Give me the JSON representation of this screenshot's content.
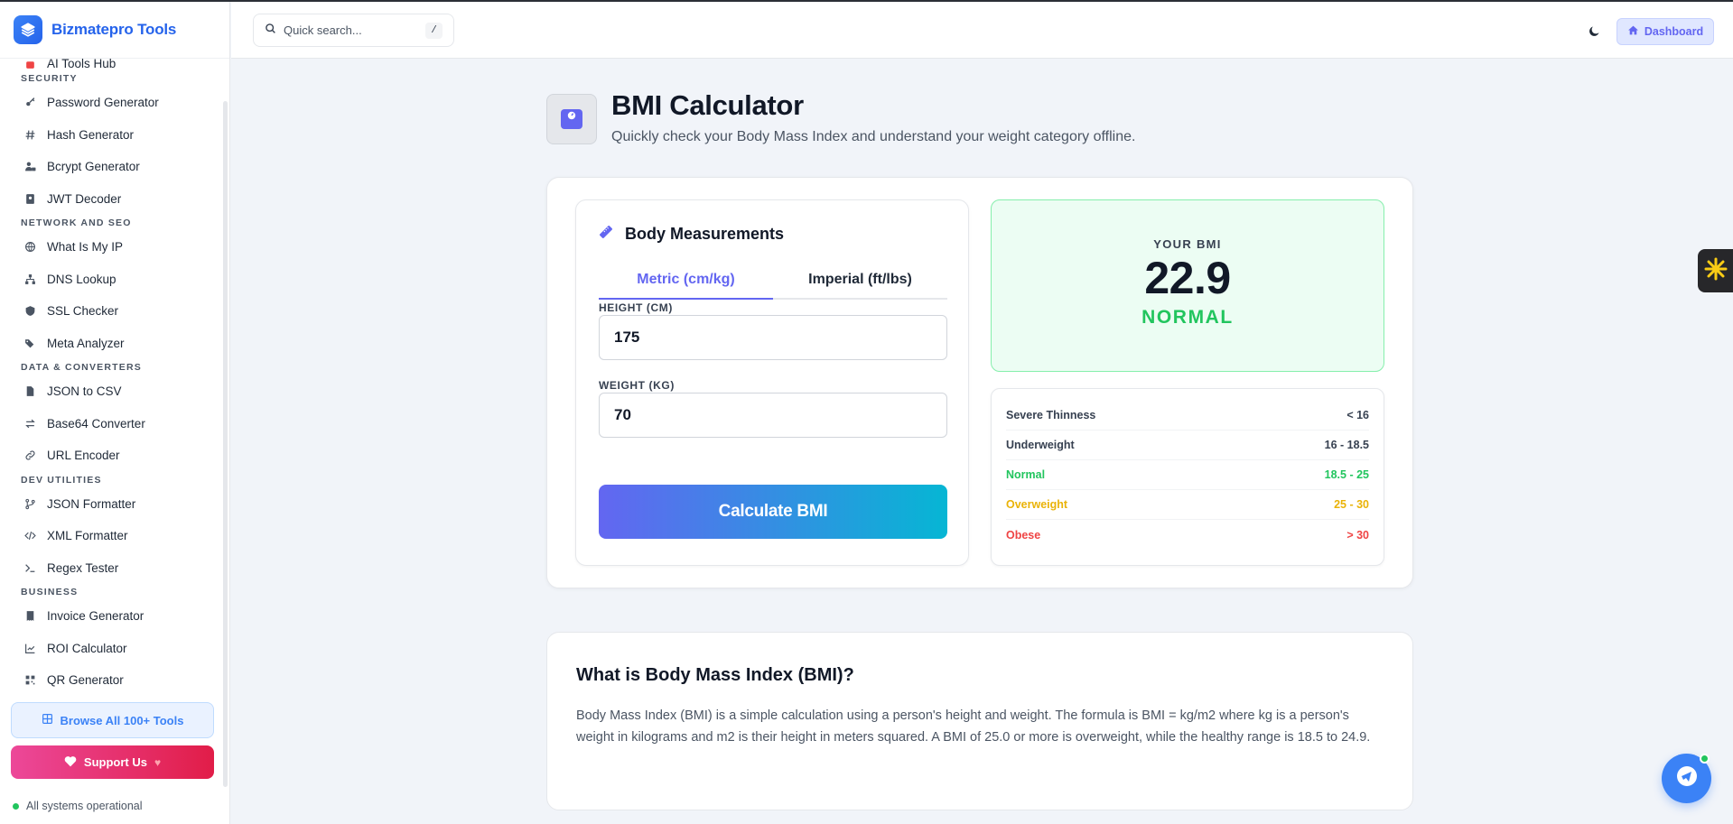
{
  "brand": {
    "name": "Bizmatepro Tools"
  },
  "sidebar": {
    "partial_item": "AI Tools Hub",
    "sections": [
      {
        "title": "SECURITY",
        "items": [
          {
            "label": "Password Generator",
            "icon": "key-icon"
          },
          {
            "label": "Hash Generator",
            "icon": "hash-icon"
          },
          {
            "label": "Bcrypt Generator",
            "icon": "user-lock-icon"
          },
          {
            "label": "JWT Decoder",
            "icon": "id-card-icon"
          }
        ]
      },
      {
        "title": "NETWORK AND SEO",
        "items": [
          {
            "label": "What Is My IP",
            "icon": "globe-icon"
          },
          {
            "label": "DNS Lookup",
            "icon": "sitemap-icon"
          },
          {
            "label": "SSL Checker",
            "icon": "shield-icon"
          },
          {
            "label": "Meta Analyzer",
            "icon": "tags-icon"
          }
        ]
      },
      {
        "title": "DATA & CONVERTERS",
        "items": [
          {
            "label": "JSON to CSV",
            "icon": "file-icon"
          },
          {
            "label": "Base64 Converter",
            "icon": "exchange-icon"
          },
          {
            "label": "URL Encoder",
            "icon": "link-icon"
          }
        ]
      },
      {
        "title": "DEV UTILITIES",
        "items": [
          {
            "label": "JSON Formatter",
            "icon": "branch-icon"
          },
          {
            "label": "XML Formatter",
            "icon": "code-icon"
          },
          {
            "label": "Regex Tester",
            "icon": "terminal-icon"
          }
        ]
      },
      {
        "title": "BUSINESS",
        "items": [
          {
            "label": "Invoice Generator",
            "icon": "invoice-icon"
          },
          {
            "label": "ROI Calculator",
            "icon": "chart-line-icon"
          },
          {
            "label": "QR Generator",
            "icon": "qrcode-icon"
          }
        ]
      }
    ],
    "browse_label": "Browse All 100+ Tools",
    "support_label": "Support Us",
    "status_text": "All systems operational"
  },
  "topbar": {
    "search_placeholder": "Quick search...",
    "search_shortcut": "/",
    "dashboard_label": "Dashboard"
  },
  "page": {
    "title": "BMI Calculator",
    "subtitle": "Quickly check your Body Mass Index and understand your weight category offline."
  },
  "form": {
    "heading": "Body Measurements",
    "tabs": [
      {
        "label": "Metric (cm/kg)",
        "active": true
      },
      {
        "label": "Imperial (ft/lbs)",
        "active": false
      }
    ],
    "height_label": "HEIGHT (CM)",
    "height_value": "175",
    "weight_label": "WEIGHT (KG)",
    "weight_value": "70",
    "calculate_label": "Calculate BMI"
  },
  "result": {
    "label": "YOUR BMI",
    "value": "22.9",
    "category": "NORMAL"
  },
  "ranges": [
    {
      "name": "Severe Thinness",
      "range": "< 16",
      "color": "#374151"
    },
    {
      "name": "Underweight",
      "range": "16 - 18.5",
      "color": "#374151"
    },
    {
      "name": "Normal",
      "range": "18.5 - 25",
      "color": "#22c55e"
    },
    {
      "name": "Overweight",
      "range": "25 - 30",
      "color": "#eab308"
    },
    {
      "name": "Obese",
      "range": "> 30",
      "color": "#ef4444"
    }
  ],
  "info": {
    "title": "What is Body Mass Index (BMI)?",
    "body": "Body Mass Index (BMI) is a simple calculation using a person's height and weight. The formula is BMI = kg/m2 where kg is a person's weight in kilograms and m2 is their height in meters squared. A BMI of 25.0 or more is overweight, while the healthy range is 18.5 to 24.9."
  },
  "colors": {
    "accent": "#6366f1",
    "brand": "#2563eb",
    "success": "#22c55e"
  }
}
